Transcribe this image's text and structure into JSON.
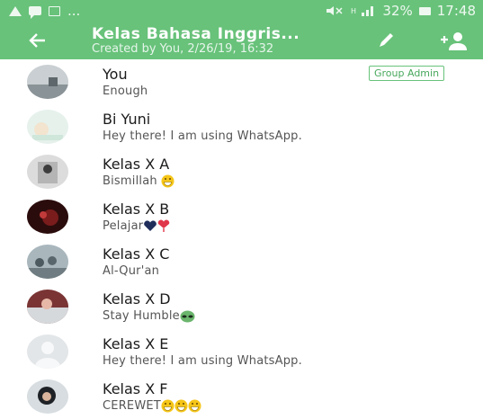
{
  "status_bar": {
    "left_text": "...",
    "signal_text": "32%",
    "time": "17:48"
  },
  "header": {
    "title": "Kelas Bahasa Inggris...",
    "subtitle": "Created by You, 2/26/19, 16:32",
    "back_icon": "arrow-left-icon",
    "edit_icon": "pencil-icon",
    "add_participant_icon": "person-add-icon"
  },
  "colors": {
    "accent": "#68c27a",
    "badge": "#48a85c"
  },
  "participants": [
    {
      "name": "You",
      "status": "Enough",
      "badge": "Group Admin",
      "emojis": []
    },
    {
      "name": "Bi Yuni",
      "status": "Hey there! I am using WhatsApp.",
      "emojis": []
    },
    {
      "name": "Kelas X A",
      "status": "Bismillah",
      "emojis": [
        "grin"
      ]
    },
    {
      "name": "Kelas X B",
      "status": "Pelajar",
      "emojis": [
        "heart-navy",
        "heart-red"
      ]
    },
    {
      "name": "Kelas X C",
      "status": "Al-Qur'an",
      "emojis": []
    },
    {
      "name": "Kelas X D",
      "status": "Stay Humble",
      "emojis": [
        "alien"
      ]
    },
    {
      "name": "Kelas X E",
      "status": "Hey there! I am using WhatsApp.",
      "emojis": []
    },
    {
      "name": "Kelas X F",
      "status": "CEREWET",
      "emojis": [
        "grin",
        "grin",
        "grin"
      ]
    }
  ]
}
